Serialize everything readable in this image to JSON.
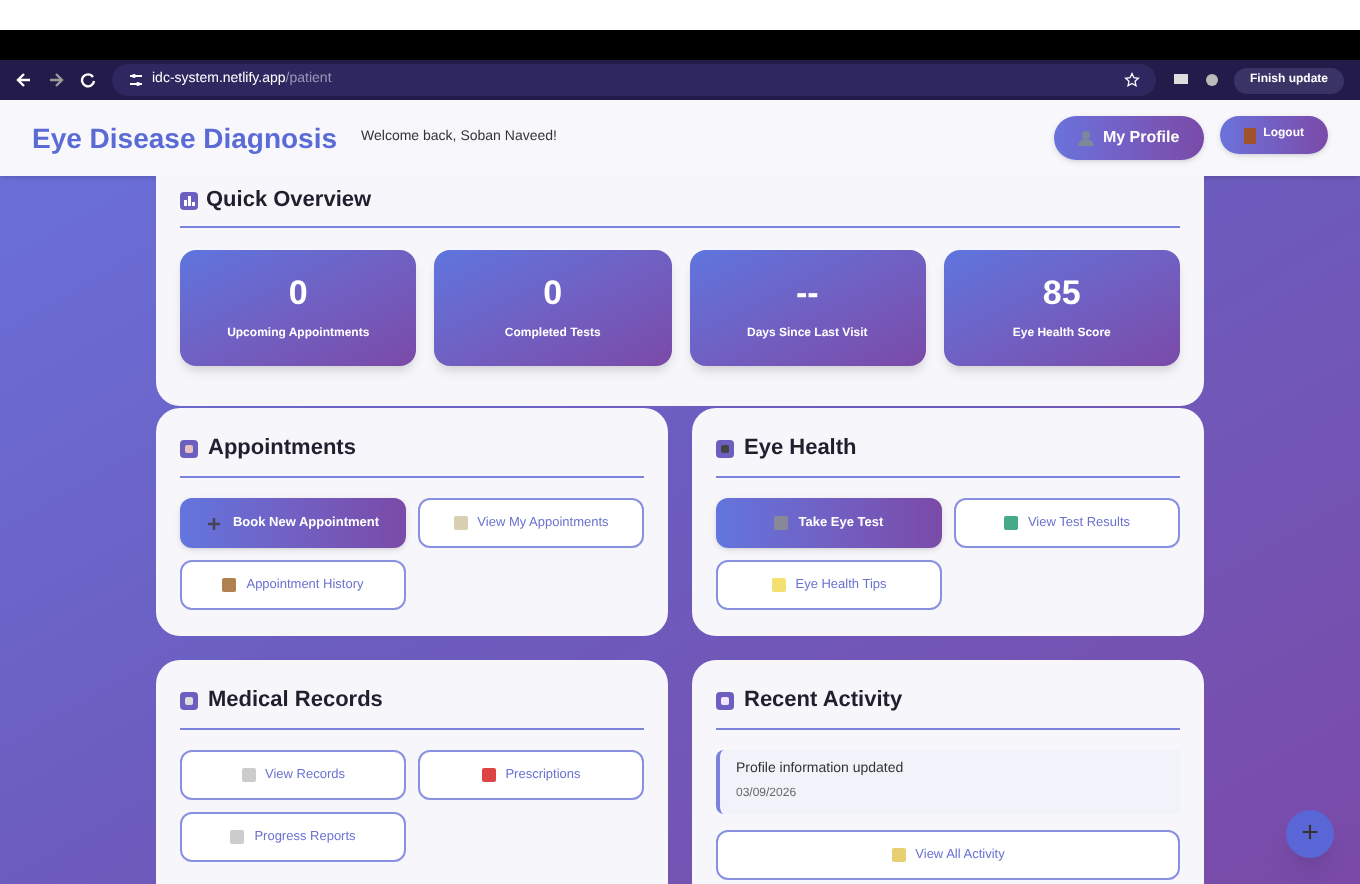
{
  "browser": {
    "url_host": "idc-system.netlify.app",
    "url_path": "/patient",
    "update_button": "Finish update"
  },
  "header": {
    "title": "Eye Disease Diagnosis",
    "welcome": "Welcome back, Soban Naveed!",
    "buttons": [
      {
        "label": "My Profile"
      },
      {
        "label": "Logout"
      }
    ]
  },
  "overview": {
    "title": "Quick Overview",
    "stats": [
      {
        "value": "0",
        "label": "Upcoming Appointments"
      },
      {
        "value": "0",
        "label": "Completed Tests"
      },
      {
        "value": "--",
        "label": "Days Since Last Visit"
      },
      {
        "value": "85",
        "label": "Eye Health Score"
      }
    ]
  },
  "panels": [
    {
      "title": "Appointments",
      "buttons": [
        {
          "label": "Book New Appointment",
          "kind": "primary"
        },
        {
          "label": "View My Appointments",
          "kind": "outline"
        },
        {
          "label": "Appointment History",
          "kind": "outline"
        }
      ]
    },
    {
      "title": "Eye Health",
      "buttons": [
        {
          "label": "Take Eye Test",
          "kind": "primary"
        },
        {
          "label": "View Test Results",
          "kind": "outline"
        },
        {
          "label": "Eye Health Tips",
          "kind": "outline"
        }
      ]
    },
    {
      "title": "Medical Records",
      "buttons": [
        {
          "label": "View Records",
          "kind": "outline"
        },
        {
          "label": "Prescriptions",
          "kind": "outline"
        },
        {
          "label": "Progress Reports",
          "kind": "outline"
        }
      ]
    },
    {
      "title": "Recent Activity",
      "activities": [
        {
          "text": "Profile information updated",
          "date": "03/09/2026"
        }
      ],
      "buttons": [
        {
          "label": "View All Activity",
          "kind": "wide"
        }
      ]
    }
  ],
  "fab": "+"
}
